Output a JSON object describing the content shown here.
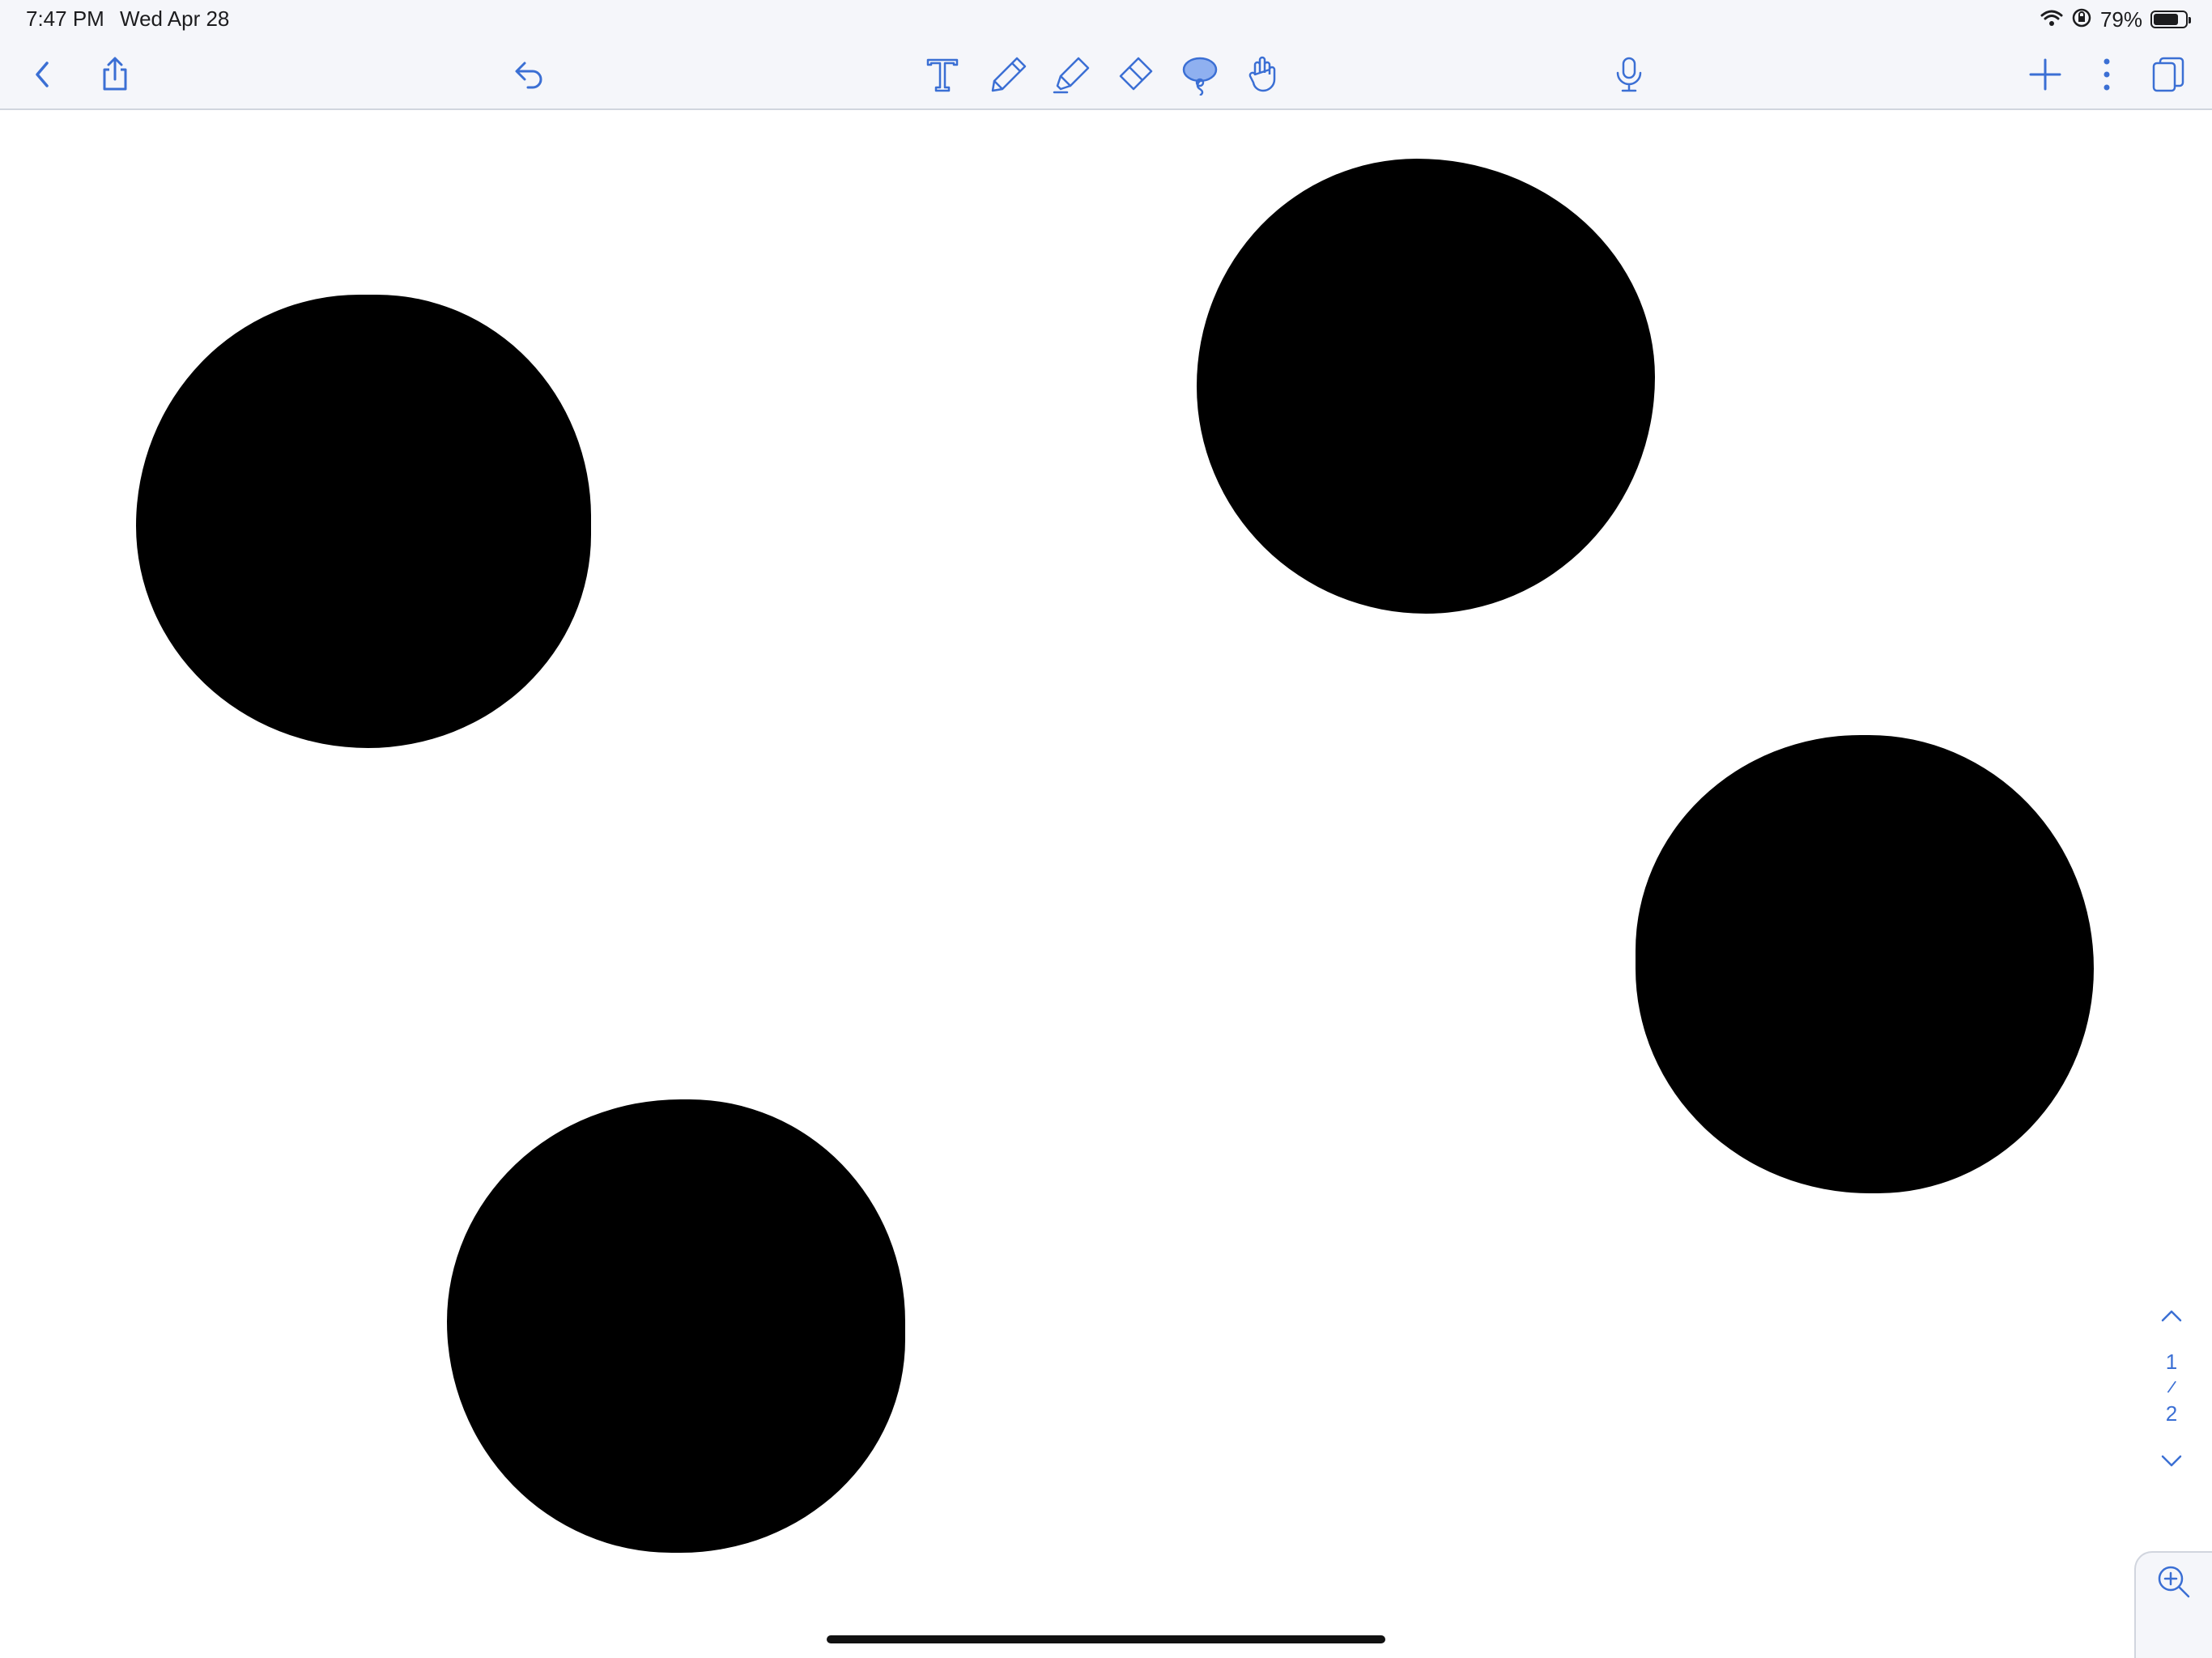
{
  "status_bar": {
    "time": "7:47 PM",
    "date": "Wed Apr 28",
    "battery_percent": "79%",
    "battery_level": 0.79,
    "icons": [
      "wifi-icon",
      "orientation-lock-icon",
      "battery-icon"
    ]
  },
  "toolbar": {
    "left": [
      "back-icon",
      "share-icon",
      "undo-icon"
    ],
    "tools": [
      "text-tool-icon",
      "pen-tool-icon",
      "highlighter-tool-icon",
      "eraser-tool-icon",
      "lasso-tool-icon",
      "hand-tool-icon"
    ],
    "active_tool": "lasso-tool-icon",
    "right": [
      "microphone-icon",
      "add-icon",
      "more-icon",
      "pages-icon"
    ],
    "accent_color": "#3b6fd4",
    "active_fill_color": "#8fb0f0"
  },
  "page_indicator": {
    "current": "1",
    "separator": "/",
    "total": "2"
  },
  "canvas": {
    "ink_color": "#000000",
    "shapes": [
      "filled-circle",
      "filled-circle",
      "filled-circle",
      "filled-circle"
    ]
  }
}
